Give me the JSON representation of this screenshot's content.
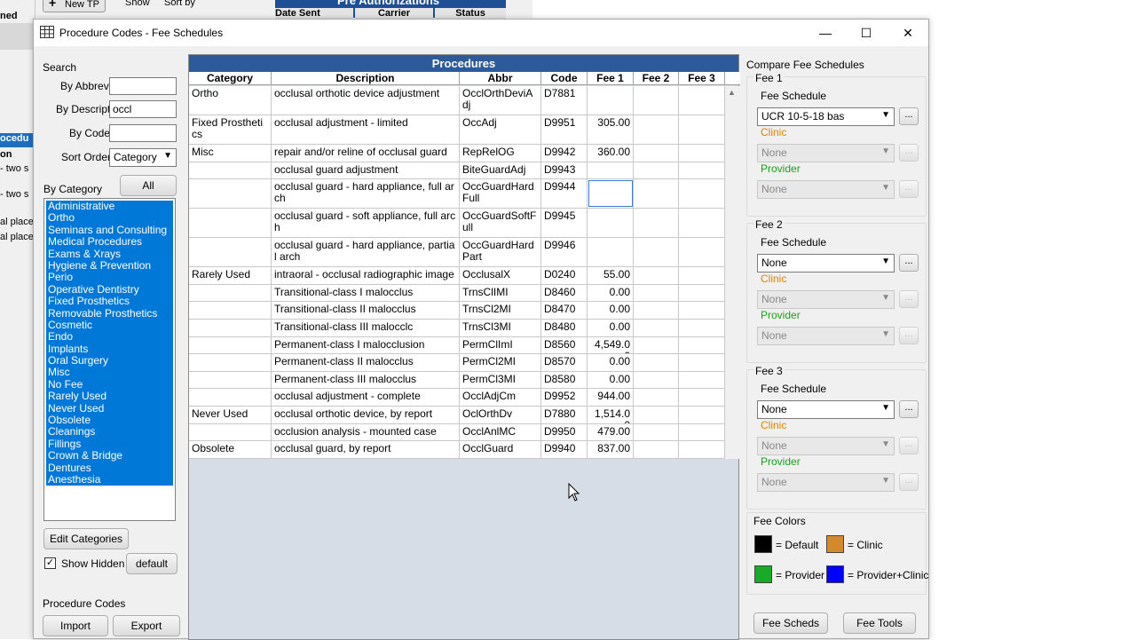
{
  "background": {
    "left_cells": [
      "ned",
      "ocedu",
      "on",
      "- two s",
      "- two s",
      "al place",
      "al place"
    ],
    "toolbar": {
      "new_tp": "New TP",
      "show": "Show",
      "sort_by": "Sort by"
    },
    "pre_auth": {
      "title": "Pre Authorizations",
      "cols": [
        "Date Sent",
        "Carrier",
        "Status"
      ]
    }
  },
  "window": {
    "title": "Procedure Codes - Fee Schedules",
    "controls": {
      "minimize": "—",
      "maximize": "☐",
      "close": "✕"
    }
  },
  "search": {
    "title": "Search",
    "by_abbrev_label": "By Abbrev",
    "by_abbrev_value": "",
    "by_descript_label": "By Descript",
    "by_descript_value": "occl",
    "by_code_label": "By Code",
    "by_code_value": "",
    "sort_order_label": "Sort Order",
    "sort_order_value": "Category"
  },
  "categories": {
    "label": "By Category",
    "all_button": "All",
    "items": [
      "Administrative",
      "Ortho",
      "Seminars and Consulting",
      "Medical Procedures",
      "Exams & Xrays",
      "Hygiene & Prevention",
      "Perio",
      "Operative Dentistry",
      "Fixed Prosthetics",
      "Removable Prosthetics",
      "Cosmetic",
      "Endo",
      "Implants",
      "Oral Surgery",
      "Misc",
      "No Fee",
      "Rarely Used",
      "Never Used",
      "Obsolete",
      "Cleanings",
      "Fillings",
      "Crown & Bridge",
      "Dentures",
      "Anesthesia"
    ],
    "edit_button": "Edit Categories",
    "show_hidden_label": "Show Hidden",
    "show_hidden_checked": true,
    "default_button": "default"
  },
  "procedure_codes": {
    "title": "Procedure Codes",
    "import_button": "Import",
    "export_button": "Export"
  },
  "grid": {
    "title": "Procedures",
    "columns": [
      "Category",
      "Description",
      "Abbr",
      "Code",
      "Fee 1",
      "Fee 2",
      "Fee 3"
    ],
    "rows": [
      {
        "category": "Ortho",
        "description": "occlusal orthotic device adjustment",
        "abbr": "OcclOrthDeviAdj",
        "code": "D7881",
        "fee1": "",
        "fee2": "",
        "fee3": ""
      },
      {
        "category": "Fixed Prosthetics",
        "description": "occlusal adjustment - limited",
        "abbr": "OccAdj",
        "code": "D9951",
        "fee1": "305.00",
        "fee2": "",
        "fee3": ""
      },
      {
        "category": "Misc",
        "description": "repair and/or reline of occlusal guard",
        "abbr": "RepRelOG",
        "code": "D9942",
        "fee1": "360.00",
        "fee2": "",
        "fee3": ""
      },
      {
        "category": "",
        "description": "occlusal guard adjustment",
        "abbr": "BiteGuardAdj",
        "code": "D9943",
        "fee1": "",
        "fee2": "",
        "fee3": ""
      },
      {
        "category": "",
        "description": "occlusal  guard - hard appliance, full arch",
        "abbr": "OccGuardHardFull",
        "code": "D9944",
        "fee1": "",
        "fee2": "",
        "fee3": ""
      },
      {
        "category": "",
        "description": "occlusal  guard - soft appliance, full arch",
        "abbr": "OccGuardSoftFull",
        "code": "D9945",
        "fee1": "",
        "fee2": "",
        "fee3": ""
      },
      {
        "category": "",
        "description": "occlusal  guard - hard appliance, partial arch",
        "abbr": "OccGuardHardPart",
        "code": "D9946",
        "fee1": "",
        "fee2": "",
        "fee3": ""
      },
      {
        "category": "Rarely Used",
        "description": "intraoral - occlusal radiographic image",
        "abbr": "OcclusalX",
        "code": "D0240",
        "fee1": "55.00",
        "fee2": "",
        "fee3": ""
      },
      {
        "category": "",
        "description": "Transitional-class I malocclus",
        "abbr": "TrnsClIMI",
        "code": "D8460",
        "fee1": "0.00",
        "fee2": "",
        "fee3": ""
      },
      {
        "category": "",
        "description": "Transitional-class II malocclus",
        "abbr": "TrnsCl2MI",
        "code": "D8470",
        "fee1": "0.00",
        "fee2": "",
        "fee3": ""
      },
      {
        "category": "",
        "description": "Transitional-class III malocclс",
        "abbr": "TrnsCl3MI",
        "code": "D8480",
        "fee1": "0.00",
        "fee2": "",
        "fee3": ""
      },
      {
        "category": "",
        "description": "Permanent-class I malocclusion",
        "abbr": "PermClImI",
        "code": "D8560",
        "fee1": "4,549.00",
        "fee2": "",
        "fee3": ""
      },
      {
        "category": "",
        "description": "Permanent-class II malocclus",
        "abbr": "PermCl2MI",
        "code": "D8570",
        "fee1": "0.00",
        "fee2": "",
        "fee3": ""
      },
      {
        "category": "",
        "description": "Permanent-class III malocclus",
        "abbr": "PermCl3MI",
        "code": "D8580",
        "fee1": "0.00",
        "fee2": "",
        "fee3": ""
      },
      {
        "category": "",
        "description": "occlusal adjustment - complete",
        "abbr": "OcclAdjCm",
        "code": "D9952",
        "fee1": "944.00",
        "fee2": "",
        "fee3": ""
      },
      {
        "category": "Never Used",
        "description": "occlusal orthotic device, by report",
        "abbr": "OclOrthDv",
        "code": "D7880",
        "fee1": "1,514.00",
        "fee2": "",
        "fee3": ""
      },
      {
        "category": "",
        "description": "occlusion analysis - mounted case",
        "abbr": "OcclAnlMC",
        "code": "D9950",
        "fee1": "479.00",
        "fee2": "",
        "fee3": ""
      },
      {
        "category": "Obsolete",
        "description": "occlusal guard, by report",
        "abbr": "OcclGuard",
        "code": "D9940",
        "fee1": "837.00",
        "fee2": "",
        "fee3": ""
      }
    ]
  },
  "compare": {
    "title": "Compare Fee Schedules",
    "fee_schedule_label": "Fee Schedule",
    "clinic_label": "Clinic",
    "provider_label": "Provider",
    "dots": "...",
    "groups": [
      {
        "name": "Fee 1",
        "schedule": "UCR 10-5-18  bas",
        "clinic": "None",
        "provider": "None"
      },
      {
        "name": "Fee 2",
        "schedule": "None",
        "clinic": "None",
        "provider": "None"
      },
      {
        "name": "Fee 3",
        "schedule": "None",
        "clinic": "None",
        "provider": "None"
      }
    ]
  },
  "fee_colors": {
    "title": "Fee Colors",
    "default_label": "= Default",
    "clinic_label": "= Clinic",
    "provider_label": "= Provider",
    "provider_clinic_label": "= Provider+Clinic",
    "default_color": "#000000",
    "clinic_color": "#d4892c",
    "provider_color": "#1aaa2a",
    "provider_clinic_color": "#0000ff"
  },
  "bottom_buttons": {
    "fee_scheds": "Fee Scheds",
    "fee_tools": "Fee Tools"
  }
}
